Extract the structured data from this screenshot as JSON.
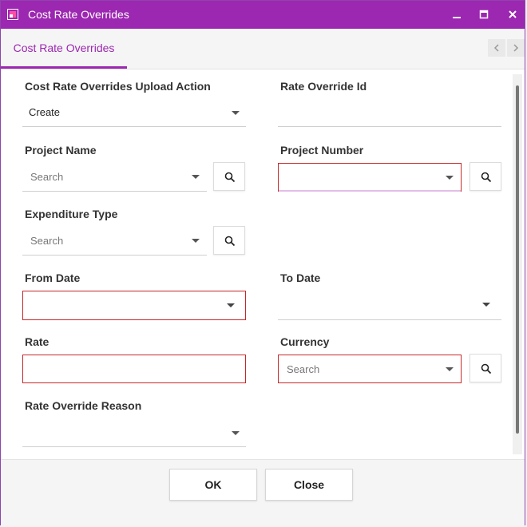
{
  "window": {
    "title": "Cost Rate Overrides",
    "minimize_glyph": "▁",
    "maximize_glyph": "☐",
    "close_glyph": "✕",
    "accent_color": "#9c27b0"
  },
  "tabs": {
    "active_label": "Cost Rate Overrides",
    "prev_glyph": "‹",
    "next_glyph": "›"
  },
  "form": {
    "upload_action": {
      "label": "Cost Rate Overrides Upload Action",
      "value": "Create"
    },
    "rate_override_id": {
      "label": "Rate Override Id",
      "value": ""
    },
    "project_name": {
      "label": "Project Name",
      "placeholder": "Search"
    },
    "project_number": {
      "label": "Project Number",
      "value": ""
    },
    "expenditure_type": {
      "label": "Expenditure Type",
      "placeholder": "Search"
    },
    "from_date": {
      "label": "From Date",
      "value": ""
    },
    "to_date": {
      "label": "To Date",
      "value": ""
    },
    "rate": {
      "label": "Rate",
      "value": ""
    },
    "currency": {
      "label": "Currency",
      "placeholder": "Search"
    },
    "rate_override_reason": {
      "label": "Rate Override Reason",
      "value": ""
    },
    "required_border_color": "#c62828"
  },
  "footer": {
    "ok_label": "OK",
    "close_label": "Close"
  }
}
